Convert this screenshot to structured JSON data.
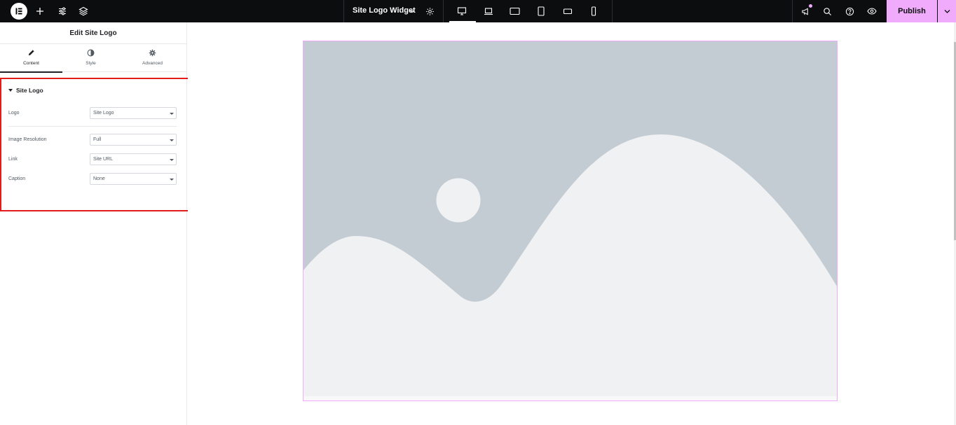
{
  "topbar": {
    "document_title": "Site Logo Widget",
    "publish_label": "Publish",
    "icons": [
      "elementor-logo-icon",
      "add-element-icon",
      "site-settings-icon",
      "structure-layers-icon",
      "chevron-down-icon",
      "page-settings-gear-icon",
      "whats-new-megaphone-icon",
      "finder-search-icon",
      "help-icon",
      "preview-eye-icon"
    ],
    "devices": [
      "desktop",
      "laptop",
      "tablet-extra",
      "tablet",
      "mobile-extra",
      "mobile"
    ],
    "active_device": "desktop",
    "accent_color": "#f0abfc"
  },
  "panel": {
    "title": "Edit Site Logo",
    "tabs": [
      {
        "label": "Content",
        "icon": "pencil-icon",
        "active": true
      },
      {
        "label": "Style",
        "icon": "half-circle-contrast-icon",
        "active": false
      },
      {
        "label": "Advanced",
        "icon": "gear-icon",
        "active": false
      }
    ],
    "section": {
      "title": "Site Logo",
      "controls": [
        {
          "label": "Logo",
          "value": "Site Logo"
        },
        {
          "label": "Image Resolution",
          "value": "Full"
        },
        {
          "label": "Link",
          "value": "Site URL"
        },
        {
          "label": "Caption",
          "value": "None"
        }
      ],
      "highlight_color": "#e41b1b"
    }
  },
  "canvas": {
    "placeholder_image": "image-placeholder-mountains-sun",
    "placeholder_colors": {
      "sky": "#c3cbd3",
      "ground": "#f0f1f3"
    },
    "widget_outline_color": "#f0abfc"
  }
}
